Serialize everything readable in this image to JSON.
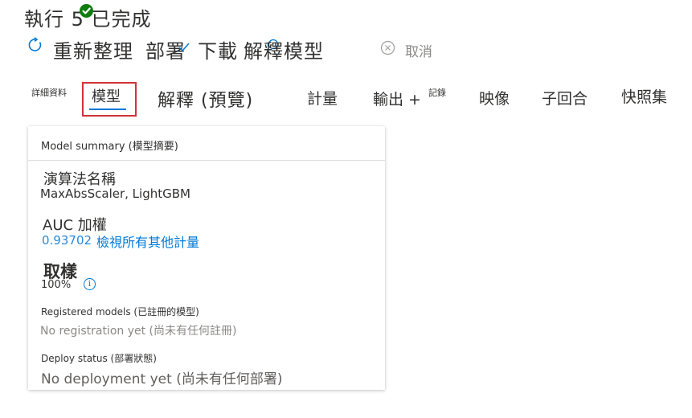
{
  "header": {
    "title": "執行 5 已完成",
    "status_icon": "check-circle-icon",
    "status_color": "#107c10"
  },
  "toolbar": {
    "refresh_label": "重新整理",
    "refresh_icon": "refresh-icon",
    "deploy_label": "部署",
    "deploy_icon": "deploy-icon",
    "download_label": "下載",
    "explain_label": "解釋模型",
    "explain_icon": "explain-icon",
    "cancel_label": "取消",
    "cancel_icon": "cancel-icon"
  },
  "tabs": {
    "details": "詳細資料",
    "model": "模型",
    "explanations": "解釋 (預覽)",
    "metrics": "計量",
    "outputs": "輸出 +",
    "outputs_logs": "記錄",
    "images": "映像",
    "child_runs": "子回合",
    "snapshot": "快照集",
    "selected": "model",
    "accent_color": "#0078d4",
    "highlight_color": "#d13438"
  },
  "summary": {
    "title": "Model summary (模型摘要)",
    "algorithm_label": "演算法名稱",
    "algorithm_value": "MaxAbsScaler, LightGBM",
    "auc_label": "AUC 加權",
    "auc_value": "0.93702",
    "view_metrics_link": "檢視所有其他計量",
    "sampling_label": "取樣",
    "sampling_value": "100%",
    "sampling_info_icon": "info-icon",
    "registered_label": "Registered models (已註冊的模型)",
    "registered_value": "No registration yet (尚未有任何註冊)",
    "deploy_status_label": "Deploy status (部署狀態)",
    "deploy_status_value": "No deployment yet (尚未有任何部署)"
  }
}
